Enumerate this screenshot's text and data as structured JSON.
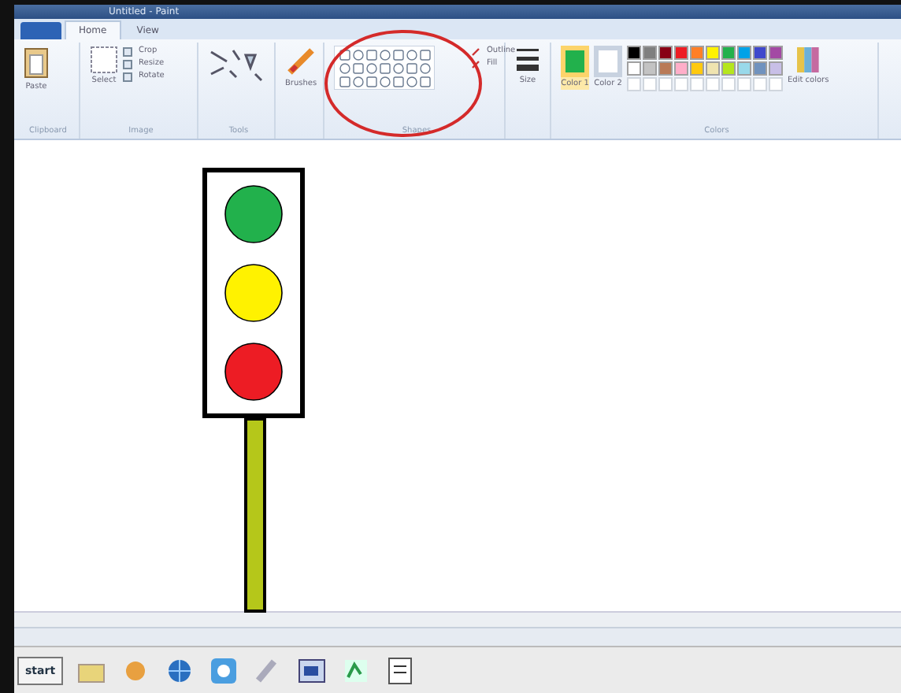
{
  "window": {
    "title": "Untitled - Paint"
  },
  "tabs": [
    {
      "label": "Home",
      "selected": true
    },
    {
      "label": "View",
      "selected": false
    }
  ],
  "ribbon": {
    "paste": "Paste",
    "crop": "Crop",
    "resize": "Resize",
    "rotate": "Rotate",
    "select": "Select",
    "brushes": "Brushes",
    "outline": "Outline",
    "fill": "Fill",
    "size": "Size",
    "color_1": "Color 1",
    "color_2": "Color 2",
    "edit_colors": "Edit colors",
    "groups": [
      "Clipboard",
      "Image",
      "Tools",
      "Shapes",
      "Colors"
    ],
    "color_1_swatch": {
      "color": "#22b14c"
    },
    "color_2_swatch": {
      "color": "#ffffff"
    },
    "palette": [
      {
        "color": "#000000"
      },
      {
        "color": "#7f7f7f"
      },
      {
        "color": "#880015"
      },
      {
        "color": "#ed1c24"
      },
      {
        "color": "#ff7f27"
      },
      {
        "color": "#fff200"
      },
      {
        "color": "#22b14c"
      },
      {
        "color": "#00a2e8"
      },
      {
        "color": "#3f48cc"
      },
      {
        "color": "#a349a4"
      },
      {
        "color": "#ffffff"
      },
      {
        "color": "#c3c3c3"
      },
      {
        "color": "#b97a57"
      },
      {
        "color": "#ffaec9"
      },
      {
        "color": "#ffc90e"
      },
      {
        "color": "#efe4b0"
      },
      {
        "color": "#b5e61d"
      },
      {
        "color": "#99d9ea"
      },
      {
        "color": "#7092be"
      },
      {
        "color": "#c8bfe7"
      }
    ]
  },
  "drawing": {
    "lights": [
      {
        "color": "#22b14c"
      },
      {
        "color": "#fff200"
      },
      {
        "color": "#ed1c24"
      }
    ],
    "pole": {
      "color": "#b5c71a"
    }
  },
  "taskbar": {
    "start": "start"
  }
}
